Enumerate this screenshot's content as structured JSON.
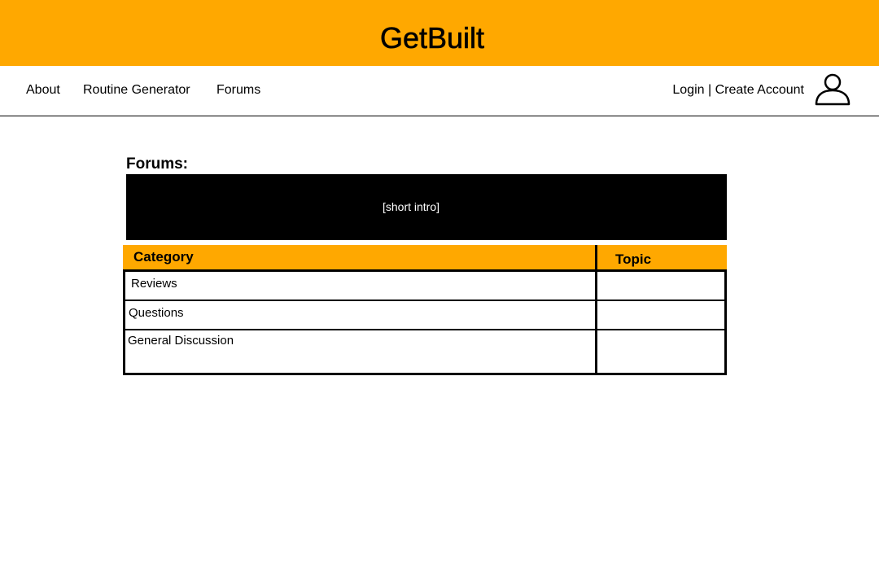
{
  "header": {
    "title": "GetBuilt",
    "background_color": "#ffa800"
  },
  "nav": {
    "about": "About",
    "routine_generator": "Routine Generator",
    "forums": "Forums"
  },
  "account": {
    "login": "Login",
    "separator": "|",
    "create_account": "Create Account",
    "avatar_icon": "user-outline-icon"
  },
  "main": {
    "heading": "Forums:",
    "intro": "[short intro]",
    "table": {
      "columns": [
        "Category",
        "Topic"
      ],
      "rows": [
        {
          "category": "Reviews",
          "topic": ""
        },
        {
          "category": "Questions",
          "topic": ""
        },
        {
          "category": "General Discussion",
          "topic": ""
        }
      ]
    }
  }
}
